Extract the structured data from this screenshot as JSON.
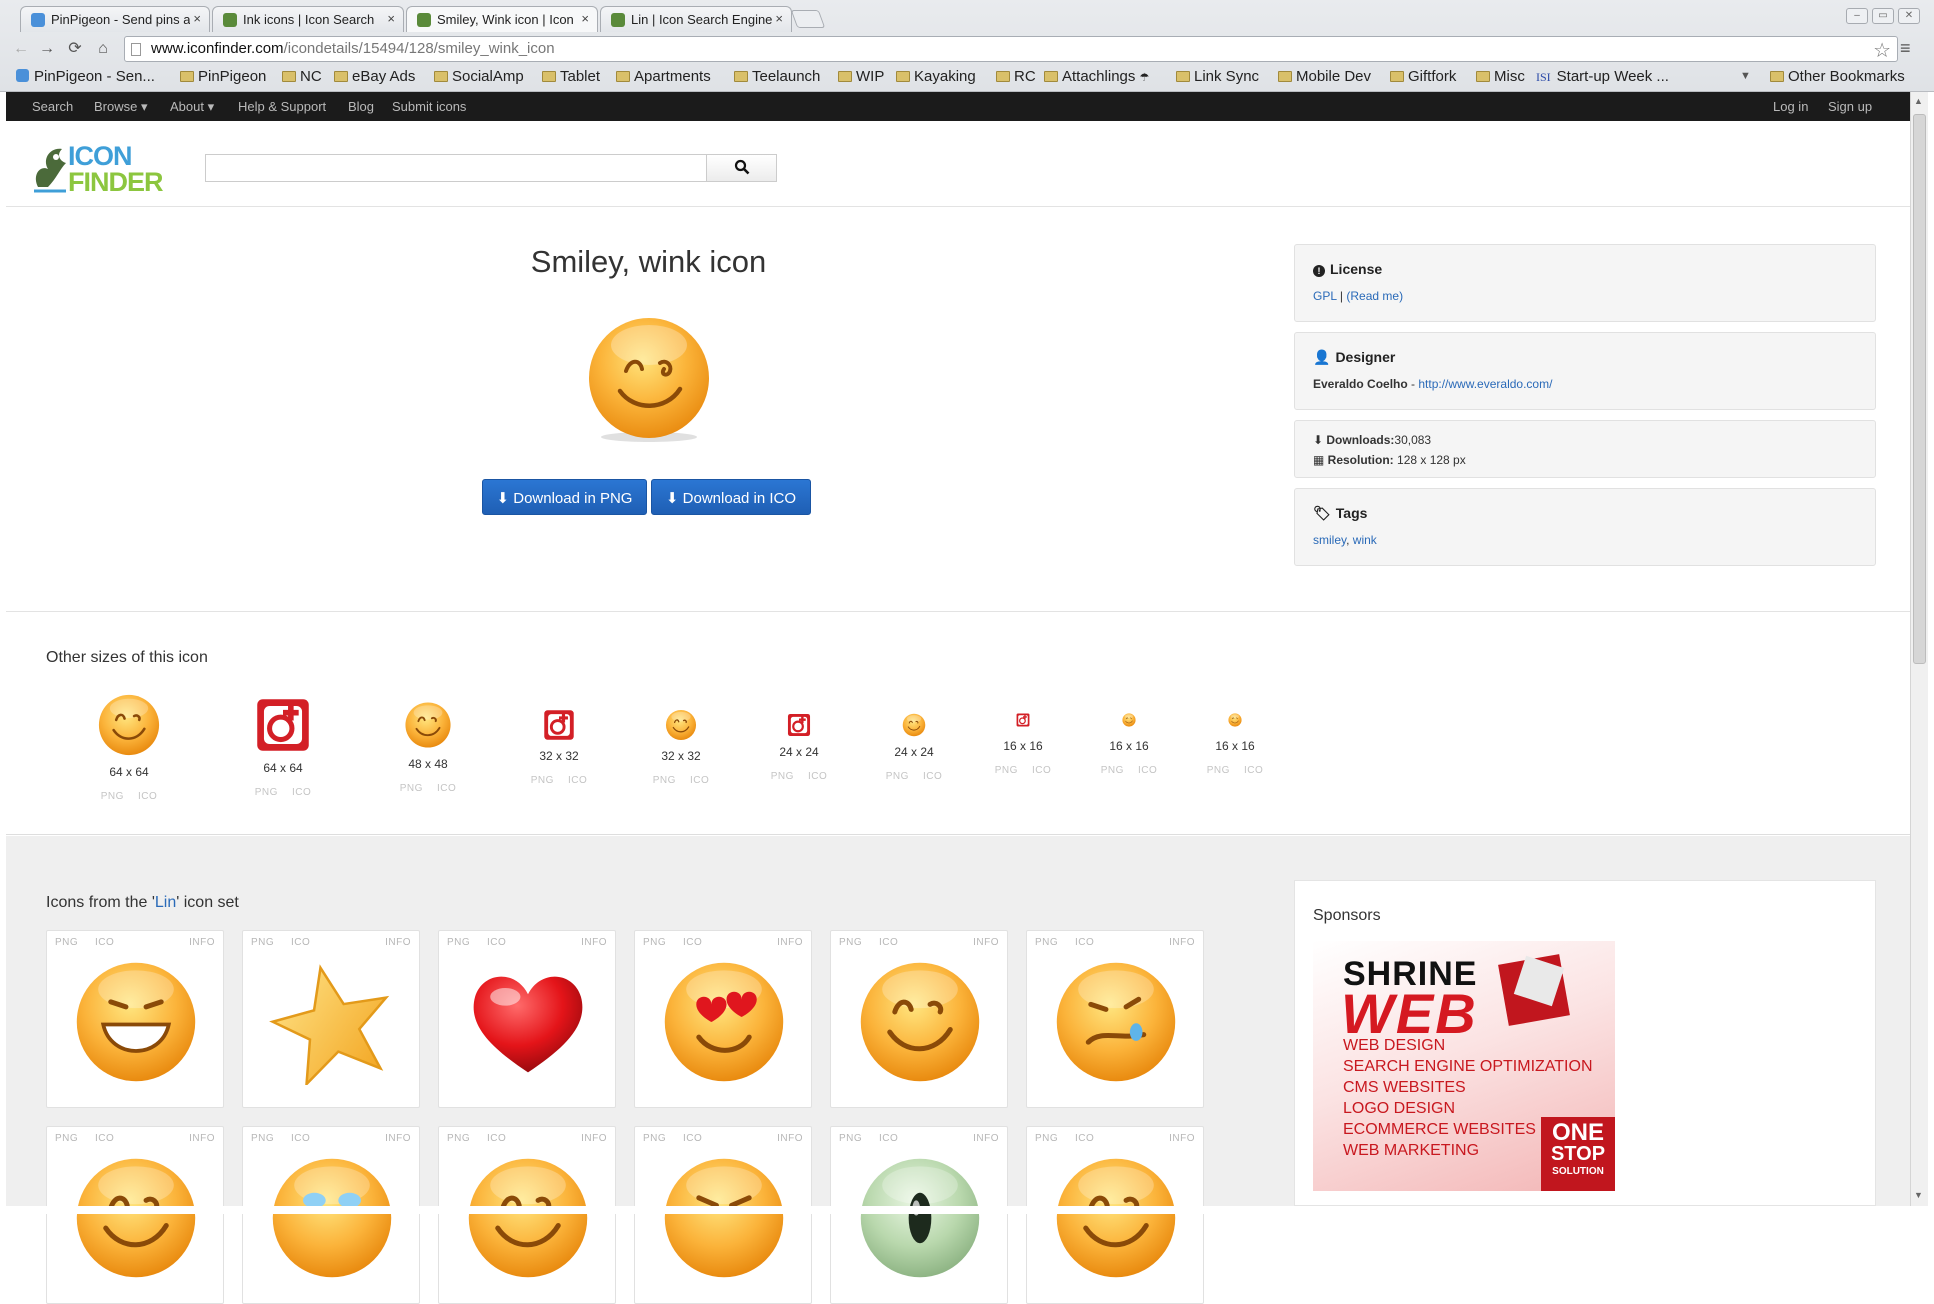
{
  "browser": {
    "tabs": [
      {
        "label": "PinPigeon - Send pins a",
        "close": "×",
        "icon_color": "#4a90d9"
      },
      {
        "label": "Ink icons | Icon Search",
        "close": "×",
        "icon_color": "#5a8a3a"
      },
      {
        "label": "Smiley, Wink icon | Icon",
        "close": "×",
        "icon_color": "#5a8a3a"
      },
      {
        "label": "Lin | Icon Search Engine",
        "close": "×",
        "icon_color": "#5a8a3a"
      }
    ],
    "nav": {
      "back": "←",
      "forward": "→",
      "reload": "⟳",
      "home": "⌂",
      "menu": "≡"
    },
    "url_host": "www.iconfinder.com",
    "url_path": "/icondetails/15494/128/smiley_wink_icon",
    "bookmarks": [
      {
        "label": "PinPigeon - Sen...",
        "kind": "favicon"
      },
      {
        "label": "PinPigeon",
        "kind": "folder"
      },
      {
        "label": "NC",
        "kind": "folder"
      },
      {
        "label": "eBay Ads",
        "kind": "folder"
      },
      {
        "label": "SocialAmp",
        "kind": "folder"
      },
      {
        "label": "Tablet",
        "kind": "folder"
      },
      {
        "label": "Apartments",
        "kind": "folder"
      },
      {
        "label": "Teelaunch",
        "kind": "folder"
      },
      {
        "label": "WIP",
        "kind": "folder"
      },
      {
        "label": "Kayaking",
        "kind": "folder"
      },
      {
        "label": "RC",
        "kind": "folder"
      },
      {
        "label": "Attachlings",
        "kind": "folder"
      },
      {
        "label": "Link Sync",
        "kind": "folder"
      },
      {
        "label": "Mobile Dev",
        "kind": "folder"
      },
      {
        "label": "Giftfork",
        "kind": "folder"
      },
      {
        "label": "Misc",
        "kind": "folder"
      },
      {
        "label": "Start-up Week ...",
        "kind": "isi"
      }
    ],
    "bookmarks_more": "▼",
    "other_bookmarks": "Other Bookmarks"
  },
  "site": {
    "topnav": {
      "search": "Search",
      "browse": "Browse ▾",
      "about": "About ▾",
      "help": "Help & Support",
      "blog": "Blog",
      "submit": "Submit icons",
      "login": "Log in",
      "signup": "Sign up"
    },
    "logo": {
      "line1": "ICON",
      "line2": "FINDER"
    },
    "search": {
      "placeholder": "",
      "button_icon": "search-icon"
    }
  },
  "detail": {
    "title": "Smiley, wink icon",
    "download_png": "Download in PNG",
    "download_ico": "Download in ICO",
    "license": {
      "heading": "License",
      "name": "GPL",
      "sep": " | ",
      "readme": "(Read me)"
    },
    "designer": {
      "heading": "Designer",
      "name": "Everaldo Coelho",
      "sep": " - ",
      "url": "http://www.everaldo.com/"
    },
    "stats": {
      "downloads_label": "Downloads:",
      "downloads_value": "30,083",
      "resolution_label": "Resolution:",
      "resolution_value": "128 x 128 px"
    },
    "tags": {
      "heading": "Tags",
      "items": [
        "smiley",
        "wink"
      ],
      "sep": ", "
    }
  },
  "other_sizes": {
    "title": "Other sizes of this icon",
    "png": "PNG",
    "ico": "ICO",
    "items": [
      {
        "label": "64 x 64",
        "kind": "smiley"
      },
      {
        "label": "64 x 64",
        "kind": "red"
      },
      {
        "label": "48 x 48",
        "kind": "smiley"
      },
      {
        "label": "32 x 32",
        "kind": "red"
      },
      {
        "label": "32 x 32",
        "kind": "smiley"
      },
      {
        "label": "24 x 24",
        "kind": "red"
      },
      {
        "label": "24 x 24",
        "kind": "smiley"
      },
      {
        "label": "16 x 16",
        "kind": "red"
      },
      {
        "label": "16 x 16",
        "kind": "smiley"
      },
      {
        "label": "16 x 16",
        "kind": "smiley-small"
      }
    ]
  },
  "icon_set": {
    "title_prefix": "Icons from the '",
    "title_link": "Lin",
    "title_suffix": "' icon set",
    "card_png": "PNG",
    "card_ico": "ICO",
    "card_info": "INFO",
    "row1": [
      "grin",
      "star",
      "heart",
      "love",
      "smile",
      "cry"
    ],
    "row2": [
      "smiley",
      "smiley-blue",
      "smiley",
      "smiley-angry",
      "alien",
      "smiley"
    ]
  },
  "sponsors": {
    "title": "Sponsors",
    "ad_brand1": "SHRINE",
    "ad_brand2": "WEB",
    "ad_services": [
      "WEB DESIGN",
      "SEARCH ENGINE OPTIMIZATION",
      "CMS WEBSITES",
      "LOGO DESIGN",
      "ECOMMERCE WEBSITES",
      "WEB MARKETING"
    ],
    "ad_stamp_1": "ONE",
    "ad_stamp_2": "STOP",
    "ad_stamp_3": "SOLUTION"
  },
  "colors": {
    "accent": "#2a6ab8",
    "button": "#2165c4",
    "smiley": "#f5a623",
    "red_icon": "#d31f26"
  }
}
